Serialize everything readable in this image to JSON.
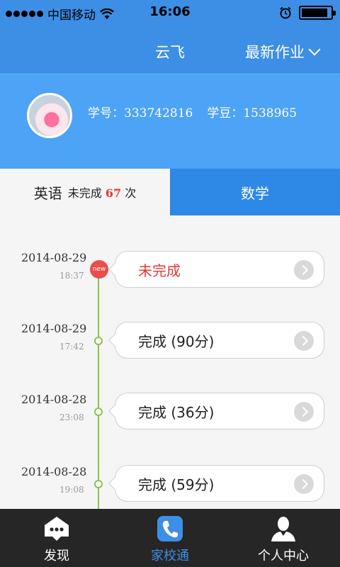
{
  "status_bar": {
    "carrier": "中国移动",
    "time": "16:06",
    "battery_level": 0.9
  },
  "navbar": {
    "title": "云飞",
    "menu_label": "最新作业"
  },
  "profile": {
    "student_id_label": "学号：",
    "student_id": "333742816",
    "beans_label": "学豆：",
    "beans": "1538965"
  },
  "tabs": {
    "english": {
      "subject": "英语",
      "status_text": "未完成",
      "count": "67",
      "unit": "次"
    },
    "math": {
      "label": "数学"
    }
  },
  "timeline": [
    {
      "date": "2014-08-29",
      "time": "18:37",
      "status": "未完成",
      "badge": "new"
    },
    {
      "date": "2014-08-29",
      "time": "17:42",
      "status": "完成 (90分)"
    },
    {
      "date": "2014-08-28",
      "time": "23:08",
      "status": "完成 (36分)"
    },
    {
      "date": "2014-08-28",
      "time": "19:08",
      "status": "完成 (59分)"
    }
  ],
  "tabbar": [
    {
      "label": "发现",
      "icon": "chat-bubble-icon"
    },
    {
      "label": "家校通",
      "icon": "phone-icon"
    },
    {
      "label": "个人中心",
      "icon": "person-icon"
    }
  ]
}
